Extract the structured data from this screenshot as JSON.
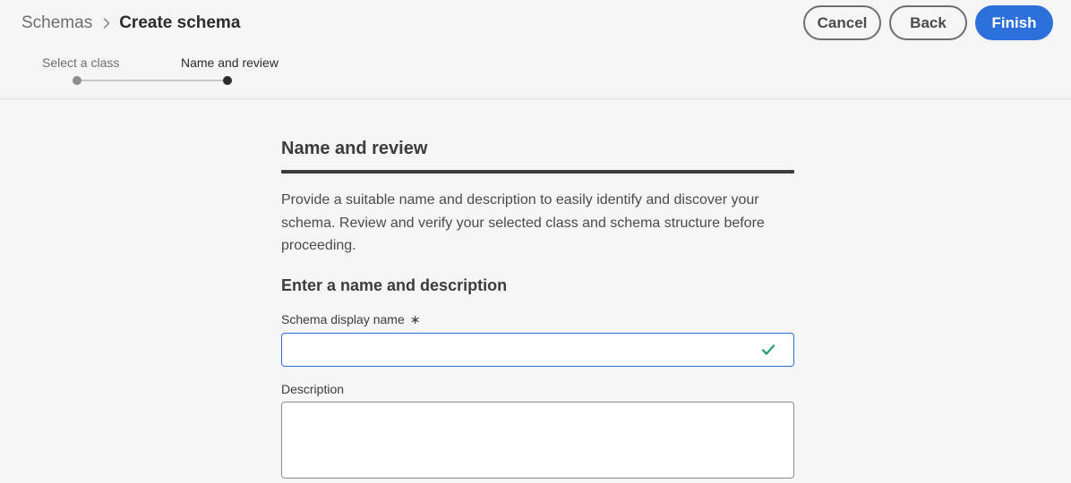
{
  "breadcrumb": {
    "parent": "Schemas",
    "separator_icon": "chevron-right-icon",
    "current": "Create schema"
  },
  "actions": {
    "cancel": "Cancel",
    "back": "Back",
    "finish": "Finish"
  },
  "stepper": {
    "steps": [
      {
        "label": "Select a class",
        "state": "completed"
      },
      {
        "label": "Name and review",
        "state": "current"
      }
    ]
  },
  "main": {
    "title": "Name and review",
    "intro": "Provide a suitable name and description to easily identify and discover your schema. Review and verify your selected class and schema structure before proceeding.",
    "subheading": "Enter a name and description",
    "display_name": {
      "label": "Schema display name",
      "required_marker": "∗",
      "value": "",
      "valid_icon": "checkmark-icon"
    },
    "description": {
      "label": "Description",
      "value": ""
    }
  },
  "colors": {
    "accent": "#2d6fdb",
    "valid": "#2d9d78",
    "background": "#f5f5f5"
  }
}
